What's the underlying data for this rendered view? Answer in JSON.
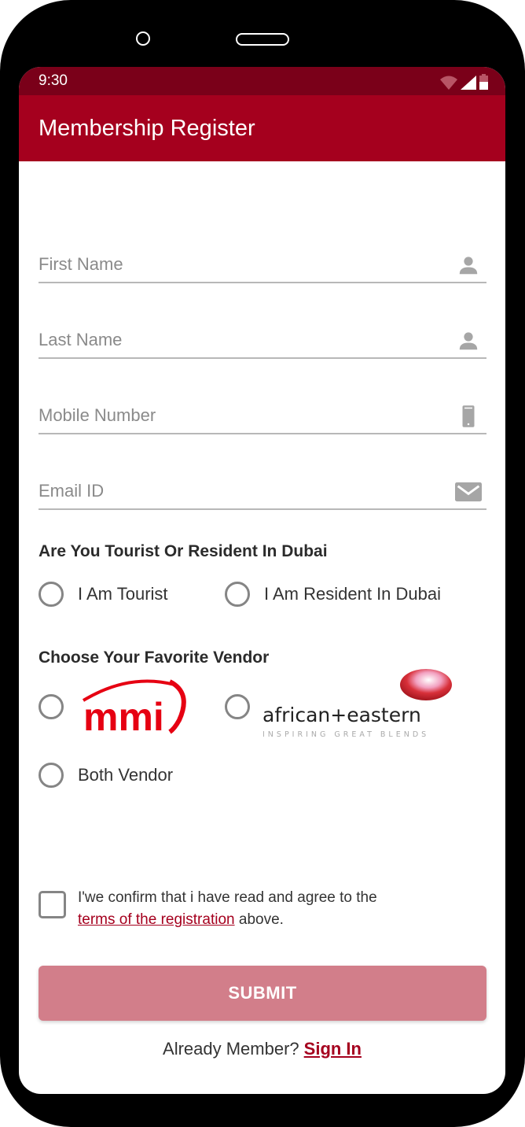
{
  "status_bar": {
    "time": "9:30",
    "icons": [
      "wifi-icon",
      "signal-icon",
      "battery-icon"
    ]
  },
  "app_bar": {
    "title": "Membership Register"
  },
  "form": {
    "fields": [
      {
        "name": "first-name",
        "placeholder": "First Name",
        "value": "",
        "icon": "person-icon"
      },
      {
        "name": "last-name",
        "placeholder": "Last Name",
        "value": "",
        "icon": "person-icon"
      },
      {
        "name": "mobile-number",
        "placeholder": "Mobile Number",
        "value": "",
        "icon": "phone-icon"
      },
      {
        "name": "email-id",
        "placeholder": "Email ID",
        "value": "",
        "icon": "email-icon"
      }
    ],
    "residency": {
      "title": "Are You Tourist Or Resident In Dubai",
      "options": [
        "I Am Tourist",
        "I Am Resident In Dubai"
      ],
      "selected": null
    },
    "vendor": {
      "title": "Choose Your Favorite Vendor",
      "options": [
        {
          "logo": "mmi",
          "text": "mmi"
        },
        {
          "logo": "african-eastern",
          "text": "african+eastern",
          "tagline": "INSPIRING GREAT BLENDS"
        },
        {
          "text": "Both Vendor"
        }
      ],
      "selected": null
    },
    "terms": {
      "checked": false,
      "text_before": "I'we confirm that i have read and agree to the",
      "link_text": "terms of the registration",
      "text_after": " above."
    },
    "submit_label": "SUBMIT",
    "signin": {
      "prompt": "Already Member?",
      "link": "Sign In"
    }
  },
  "colors": {
    "primary": "#a5001e",
    "status_bar": "#7a0019",
    "submit_disabled": "#d27e8a"
  }
}
